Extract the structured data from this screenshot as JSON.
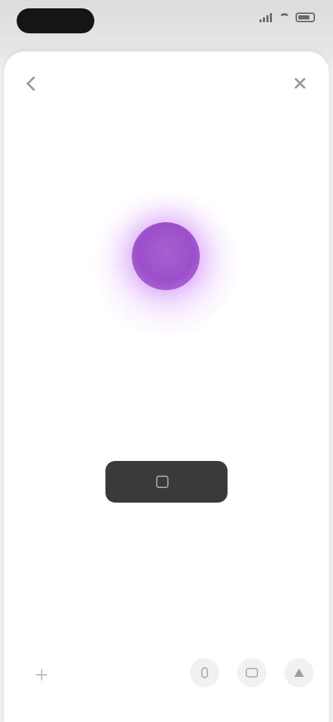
{
  "status_bar": {
    "time": "",
    "icons": [
      "signal-icon",
      "wifi-icon",
      "battery-icon"
    ]
  },
  "sheet": {
    "title": "",
    "back_icon": "chevron-left-icon",
    "close_icon": "close-icon"
  },
  "illustration": {
    "icon": "orb-icon",
    "label": "",
    "colors": {
      "orb": "#9c4fcb",
      "glow": "#e4b8fb"
    }
  },
  "content": {
    "headline": "",
    "description": "",
    "primary_button_label": "",
    "footnote": ""
  },
  "bottom_bar": {
    "left_icon": "plus-icon",
    "right_icons": [
      "mic-icon",
      "camera-icon",
      "send-icon"
    ]
  },
  "colors": {
    "button_bg": "#3a3a3a",
    "sheet_bg": "#ffffff",
    "page_bg": "#e9e9e9"
  }
}
